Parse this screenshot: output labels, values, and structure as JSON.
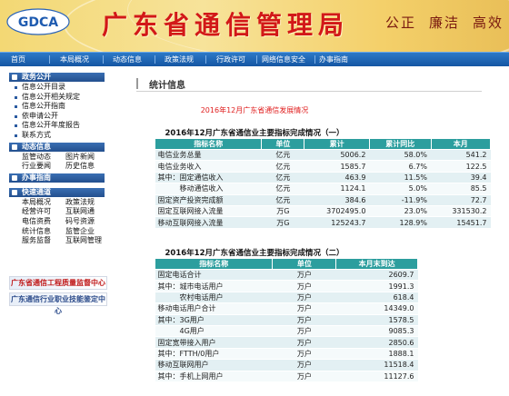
{
  "banner": {
    "logo_text": "GDCA",
    "title": "广东省通信管理局",
    "slogan": [
      "公正",
      "廉洁",
      "高效"
    ]
  },
  "nav": [
    "首页",
    "本局概况",
    "动态信息",
    "政策法规",
    "行政许可",
    "网络信息安全",
    "办事指南"
  ],
  "sidebar": {
    "sections": [
      {
        "title": "政务公开",
        "items": [
          "信息公开目录",
          "信息公开相关规定",
          "信息公开指南",
          "依申请公开",
          "信息公开年度报告",
          "联系方式"
        ]
      },
      {
        "title": "动态信息",
        "pairs": [
          [
            "监管动态",
            "图片新闻"
          ],
          [
            "行业要闻",
            "历史信息"
          ]
        ]
      },
      {
        "title": "办事指南",
        "pairs": []
      },
      {
        "title": "快速通道",
        "pairs": [
          [
            "本局概况",
            "政策法规"
          ],
          [
            "经营许可",
            "互联网通"
          ],
          [
            "电信资费",
            "码号资源"
          ],
          [
            "统计信息",
            "监管企业"
          ],
          [
            "服务监督",
            "互联网管理"
          ]
        ]
      }
    ],
    "promos": [
      "广东省通信工程质量监督中心",
      "广东通信行业职业技能鉴定中心"
    ]
  },
  "main": {
    "section_title": "统计信息",
    "report_title": "2016年12月广东省通信发展情况",
    "table1": {
      "title": "2016年12月广东省通信业主要指标完成情况（一）",
      "headers": [
        "指标名称",
        "单位",
        "累计",
        "累计同比",
        "本月"
      ],
      "rows": [
        [
          "电信业务总量",
          "亿元",
          "5006.2",
          "58.0%",
          "541.2"
        ],
        [
          "电信业务收入",
          "亿元",
          "1585.7",
          "6.7%",
          "122.5"
        ],
        [
          "其中：固定通信收入",
          "亿元",
          "463.9",
          "11.5%",
          "39.4"
        ],
        [
          "　　　移动通信收入",
          "亿元",
          "1124.1",
          "5.0%",
          "85.5"
        ],
        [
          "固定资产投资完成额",
          "亿元",
          "384.6",
          "-11.9%",
          "72.7"
        ],
        [
          "固定互联网接入流量",
          "万G",
          "3702495.0",
          "23.0%",
          "331530.2"
        ],
        [
          "移动互联网接入流量",
          "万G",
          "125243.7",
          "128.9%",
          "15451.7"
        ]
      ]
    },
    "table2": {
      "title": "2016年12月广东省通信业主要指标完成情况（二）",
      "headers": [
        "指标名称",
        "单位",
        "本月末到达"
      ],
      "rows": [
        [
          "固定电话合计",
          "万户",
          "2609.7"
        ],
        [
          "其中：城市电话用户",
          "万户",
          "1991.3"
        ],
        [
          "　　　农村电话用户",
          "万户",
          "618.4"
        ],
        [
          "移动电话用户合计",
          "万户",
          "14349.0"
        ],
        [
          "其中：3G用户",
          "万户",
          "1578.5"
        ],
        [
          "　　　4G用户",
          "万户",
          "9085.3"
        ],
        [
          "固定宽带接入用户",
          "万户",
          "2850.6"
        ],
        [
          "其中：FTTH/0用户",
          "万户",
          "1888.1"
        ],
        [
          "移动互联网用户",
          "万户",
          "11518.4"
        ],
        [
          "其中：手机上网用户",
          "万户",
          "11127.6"
        ]
      ]
    }
  }
}
